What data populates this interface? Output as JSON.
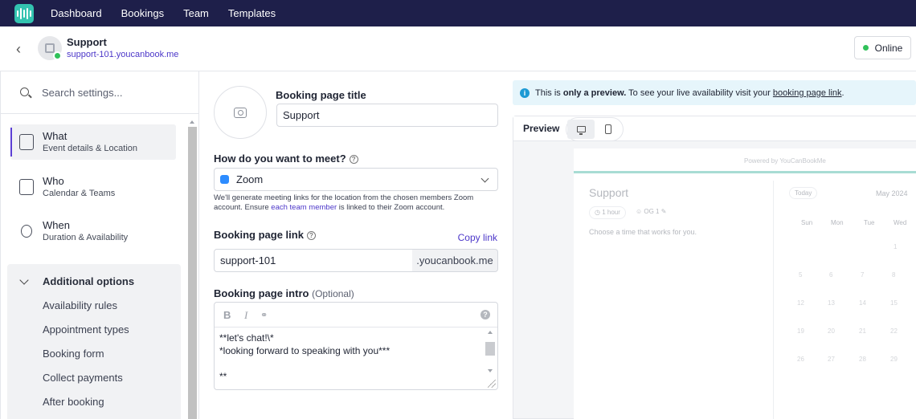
{
  "nav": {
    "items": [
      "Dashboard",
      "Bookings",
      "Team",
      "Templates"
    ]
  },
  "header": {
    "title": "Support",
    "url": "support-101.youcanbook.me",
    "status": "Online"
  },
  "sidebar": {
    "search_placeholder": "Search settings...",
    "sections": [
      {
        "title": "What",
        "subtitle": "Event details & Location",
        "icon": "details-icon",
        "active": true
      },
      {
        "title": "Who",
        "subtitle": "Calendar & Teams",
        "icon": "calendar-user-icon",
        "active": false
      },
      {
        "title": "When",
        "subtitle": "Duration & Availability",
        "icon": "watch-icon",
        "active": false
      }
    ],
    "additional": {
      "title": "Additional options",
      "items": [
        "Availability rules",
        "Appointment types",
        "Booking form",
        "Collect payments",
        "After booking"
      ]
    }
  },
  "form": {
    "title_label": "Booking page title",
    "title_value": "Support",
    "meet_label": "How do you want to meet?",
    "meet_value": "Zoom",
    "meet_note_1": "We'll generate meeting links for the location from the chosen members Zoom account. Ensure ",
    "meet_note_link": "each team member",
    "meet_note_2": " is linked to their Zoom account.",
    "link_label": "Booking page link",
    "copy_link": "Copy link",
    "link_value": "support-101",
    "link_suffix": ".youcanbook.me",
    "intro_label": "Booking page intro",
    "intro_optional": "(Optional)",
    "intro_lines": [
      "**let's chat!\\*",
      "*looking forward to speaking with you***",
      "",
      "**"
    ]
  },
  "preview": {
    "info_1": "This is ",
    "info_bold": "only a preview.",
    "info_2": " To see your live availability visit your ",
    "info_link": "booking page link",
    "info_end": ".",
    "label": "Preview",
    "powered": "Powered by YouCanBookMe",
    "title": "Support",
    "duration": "1 hour",
    "host": "OG 1",
    "subtitle": "Choose a time that works for you.",
    "today": "Today",
    "month": "May 2024",
    "weekdays": [
      "Sun",
      "Mon",
      "Tue",
      "Wed"
    ],
    "weeks": [
      [
        "",
        "",
        "",
        "1"
      ],
      [
        "5",
        "6",
        "7",
        "8"
      ],
      [
        "12",
        "13",
        "14",
        "15"
      ],
      [
        "19",
        "20",
        "21",
        "22"
      ],
      [
        "26",
        "27",
        "28",
        "29"
      ]
    ]
  },
  "colors": {
    "nav_bg": "#1e1f4a",
    "accent": "#4c37c9",
    "brand": "#33c3b0",
    "online": "#31c15a",
    "info_bg": "#e6f5fb"
  }
}
